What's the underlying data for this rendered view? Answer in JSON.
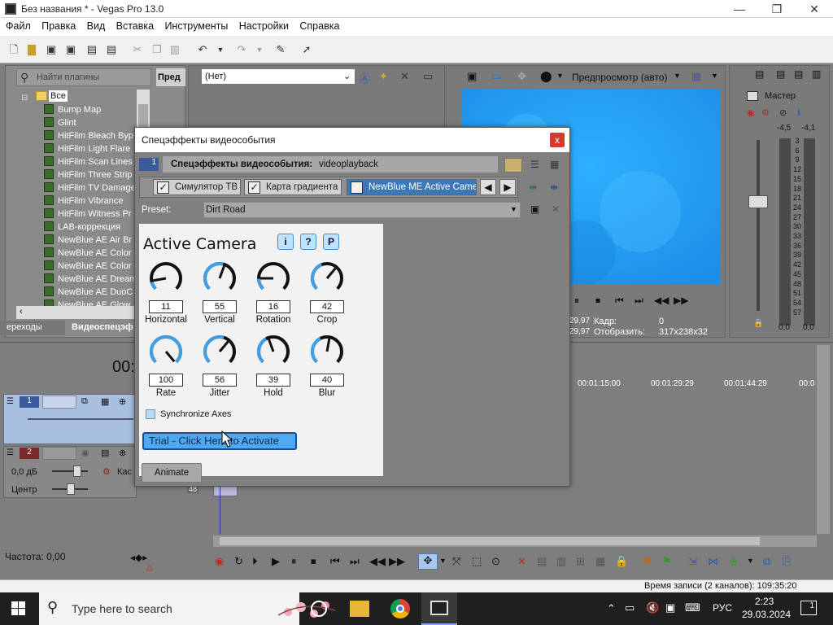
{
  "window": {
    "title": "Без названия * - Vegas Pro 13.0",
    "min": "—",
    "max": "❐",
    "close": "✕"
  },
  "menu": [
    "Файл",
    "Правка",
    "Вид",
    "Вставка",
    "Инструменты",
    "Настройки",
    "Справка"
  ],
  "plugins": {
    "search_placeholder": "Найти плагины",
    "col_header": "Пред",
    "root": "Все",
    "items": [
      "Bump Map",
      "Glint",
      "HitFilm Bleach Byp",
      "HitFilm Light Flare",
      "HitFilm Scan Lines",
      "HitFilm Three Strip",
      "HitFilm TV Damage",
      "HitFilm Vibrance",
      "HitFilm Witness Pr",
      "LAB-коррекция",
      "NewBlue AE Air Br",
      "NewBlue AE Color",
      "NewBlue AE Color",
      "NewBlue AE Dream",
      "NewBlue AE DuoC",
      "NewBlue AE Glow"
    ],
    "tabs": [
      "ереходы",
      "Видеоспецэф"
    ]
  },
  "media_combo": "(Нет)",
  "preview": {
    "mode": "Предпросмотр (авто)",
    "frame_label": "Кадр:",
    "frame_value": "0",
    "display_label": "Отобразить:",
    "display_value": "317x238x32",
    "left_vals": [
      "29,97",
      "29,97"
    ]
  },
  "master": {
    "title": "Мастер",
    "left_db": "-4,5",
    "right_db": "-4,1",
    "bottom_left": "0,0",
    "bottom_right": "0,0",
    "scale": [
      "3",
      "6",
      "9",
      "12",
      "15",
      "18",
      "21",
      "24",
      "27",
      "30",
      "33",
      "36",
      "39",
      "42",
      "45",
      "48",
      "51",
      "54",
      "57"
    ]
  },
  "dialog": {
    "title": "Спецэффекты видеособытия",
    "close": "x",
    "header_label": "Спецэффекты видеособытия:",
    "header_value": "videoplayback",
    "chain_num": "1",
    "fx_tabs": [
      "Симулятор ТВ",
      "Карта градиента",
      "NewBlue ME Active Camer"
    ],
    "preset_label": "Preset:",
    "preset_value": "Dirt Road",
    "plugin_title": "Active Camera",
    "info_buttons": [
      "i",
      "?",
      "P"
    ],
    "knobs": [
      {
        "value": "11",
        "label": "Horizontal"
      },
      {
        "value": "55",
        "label": "Vertical"
      },
      {
        "value": "16",
        "label": "Rotation"
      },
      {
        "value": "42",
        "label": "Crop"
      },
      {
        "value": "100",
        "label": "Rate"
      },
      {
        "value": "56",
        "label": "Jitter"
      },
      {
        "value": "39",
        "label": "Hold"
      },
      {
        "value": "40",
        "label": "Blur"
      }
    ],
    "sync_label": "Synchronize Axes",
    "trial_label": "Trial - Click Here to Activate",
    "animate_label": "Animate"
  },
  "timeline": {
    "time": "00:",
    "ruler": [
      "00:01:15:00",
      "00:01:29:29",
      "00:01:44:29",
      "00:0"
    ],
    "track1_num": "1",
    "track2_num": "2",
    "track2_db": "0,0 дБ",
    "track2_pan": "Центр",
    "track2_fx_label": "Кас",
    "clip_label": "48",
    "rate": "Частота: 0,00"
  },
  "status": {
    "record_time": "Время записи (2 каналов): 109:35:20"
  },
  "taskbar": {
    "search": "Type here to search",
    "lang": "РУС",
    "time": "2:23",
    "date": "29.03.2024",
    "notif": "1"
  }
}
